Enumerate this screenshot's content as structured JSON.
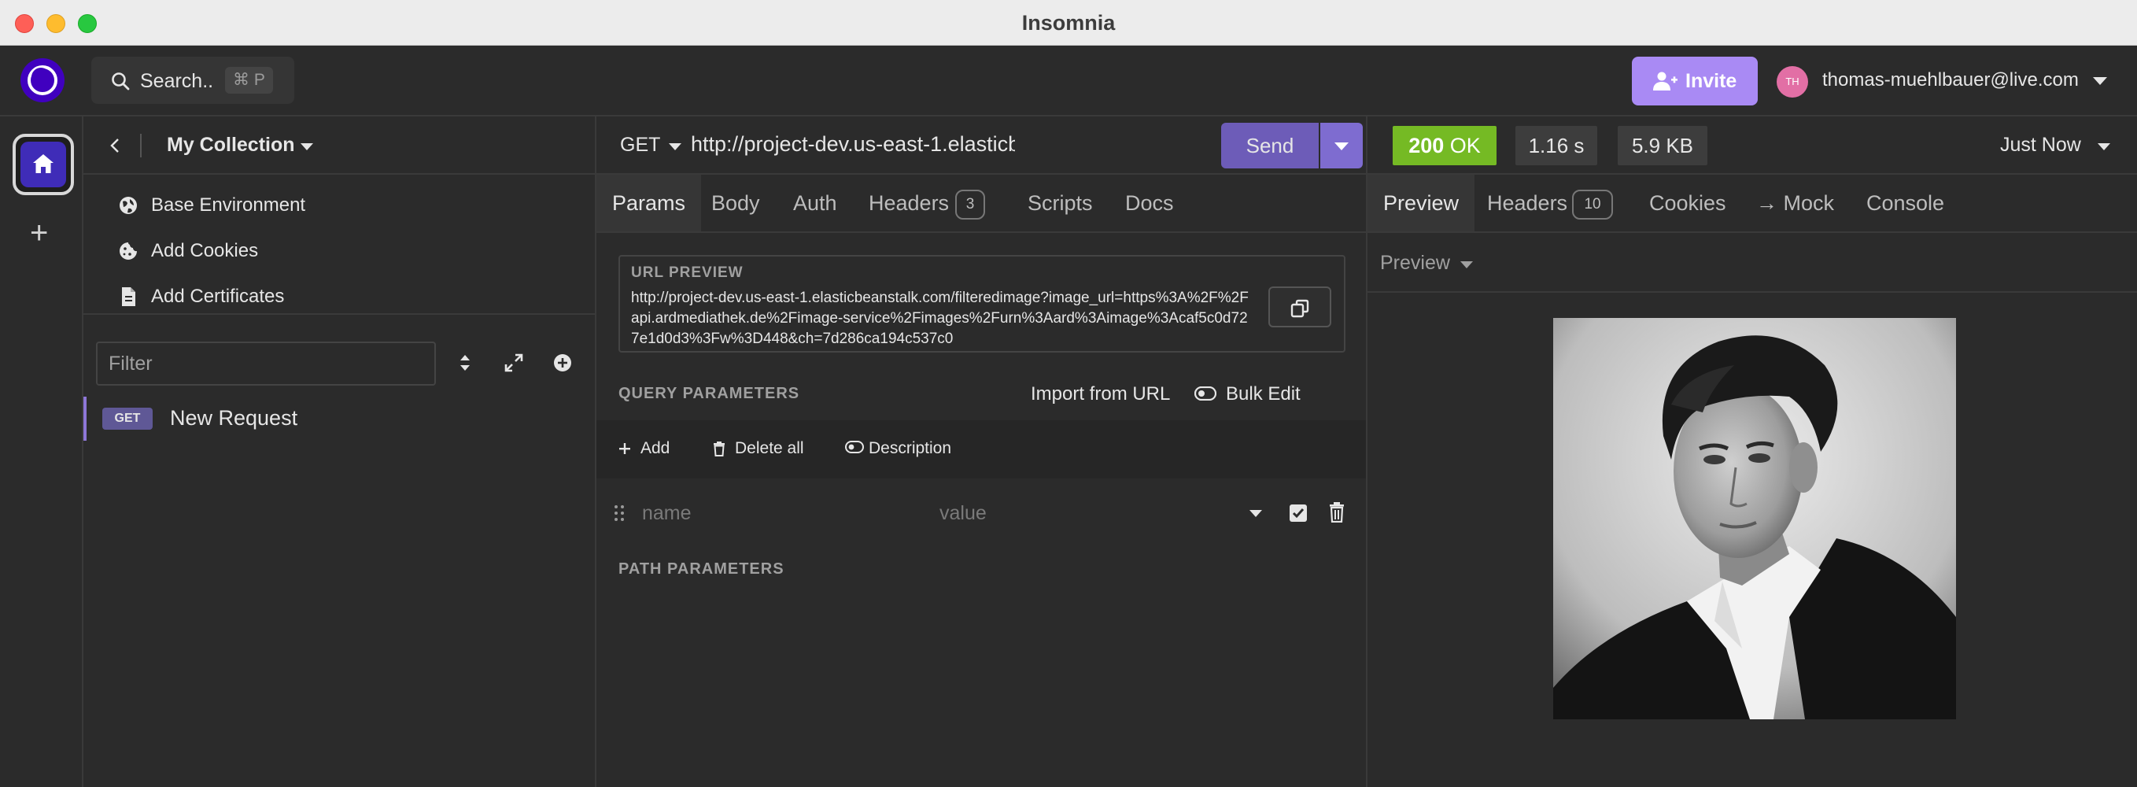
{
  "window": {
    "title": "Insomnia"
  },
  "topbar": {
    "search_label": "Search..",
    "search_shortcut": "⌘ P",
    "invite_label": "Invite",
    "avatar_initials": "TH",
    "user_email": "thomas-muehlbauer@live.com"
  },
  "sidebar": {
    "collection_name": "My Collection",
    "items": [
      {
        "label": "Base Environment",
        "icon": "globe-icon"
      },
      {
        "label": "Add Cookies",
        "icon": "cookie-icon"
      },
      {
        "label": "Add Certificates",
        "icon": "certificate-icon"
      }
    ],
    "filter_placeholder": "Filter",
    "requests": [
      {
        "method": "GET",
        "name": "New Request"
      }
    ]
  },
  "request": {
    "method": "GET",
    "url": "http://project-dev.us-east-1.elasticbeanstalk.com/filteredimage?image_url=https%3A%2F%2Fapi.ardmediathek.de%2Fimage-service%2Fimages%2Furn%3Aard%3Aimage%3Acaf5c0d727e1d0d3%3Fw%3D448&ch=7d286ca194c537c0",
    "send_label": "Send",
    "tabs": [
      {
        "label": "Params",
        "active": true
      },
      {
        "label": "Body"
      },
      {
        "label": "Auth"
      },
      {
        "label": "Headers",
        "count": "3"
      },
      {
        "label": "Scripts"
      },
      {
        "label": "Docs"
      }
    ],
    "url_preview_label": "URL PREVIEW",
    "url_preview": "http://project-dev.us-east-1.elasticbeanstalk.com/filteredimage?image_url=https%3A%2F%2Fapi.ardmediathek.de%2Fimage-service%2Fimages%2Furn%3Aard%3Aimage%3Acaf5c0d727e1d0d3%3Fw%3D448&ch=7d286ca194c537c0",
    "query_params_label": "QUERY PARAMETERS",
    "import_from_url": "Import from URL",
    "bulk_edit": "Bulk Edit",
    "add_label": "Add",
    "delete_all_label": "Delete all",
    "description_label": "Description",
    "param_name_placeholder": "name",
    "param_value_placeholder": "value",
    "path_params_label": "PATH PARAMETERS"
  },
  "response": {
    "status_code": "200",
    "status_text": "OK",
    "time": "1.16 s",
    "size": "5.9 KB",
    "time_ago": "Just Now",
    "tabs": [
      {
        "label": "Preview",
        "active": true
      },
      {
        "label": "Headers",
        "count": "10"
      },
      {
        "label": "Cookies"
      },
      {
        "label": "→ Mock"
      },
      {
        "label": "Console"
      }
    ],
    "preview_mode": "Preview",
    "image": "black-and-white portrait photo"
  },
  "colors": {
    "accent": "#7e6cd0",
    "status_ok": "#75ba24",
    "logo": "#4000bf",
    "invite": "#a98af4"
  }
}
